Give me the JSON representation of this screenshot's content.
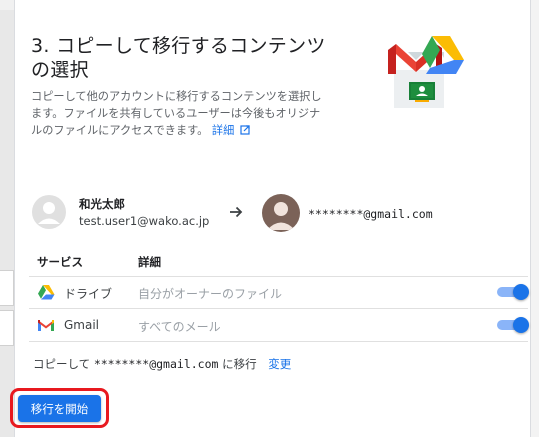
{
  "section": {
    "title": "3. コピーして移行するコンテンツの選択",
    "description": "コピーして他のアカウントに移行するコンテンツを選択します。ファイルを共有しているユーザーは今後もオリジナルのファイルにアクセスできます。",
    "details_link": "詳細"
  },
  "source_account": {
    "name": "和光太郎",
    "email": "test.user1@wako.ac.jp"
  },
  "destination_account": {
    "email": "********@gmail.com"
  },
  "table": {
    "headers": [
      "サービス",
      "詳細"
    ],
    "rows": [
      {
        "service": "ドライブ",
        "detail": "自分がオーナーのファイル",
        "icon": "google-drive-icon",
        "enabled": true
      },
      {
        "service": "Gmail",
        "detail": "すべてのメール",
        "icon": "gmail-icon",
        "enabled": true
      }
    ]
  },
  "summary": {
    "prefix": "コピーして",
    "email": "********@gmail.com",
    "suffix": "に移行",
    "change_link": "変更"
  },
  "actions": {
    "start_button": "移行を開始"
  },
  "colors": {
    "accent": "#1a73e8",
    "highlight": "#e8191f"
  }
}
